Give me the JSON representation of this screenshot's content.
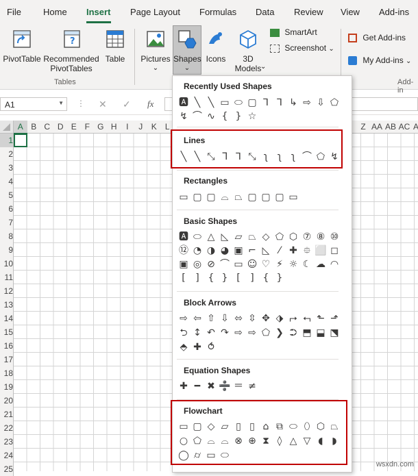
{
  "tabs": [
    "File",
    "Home",
    "Insert",
    "Page Layout",
    "Formulas",
    "Data",
    "Review",
    "View",
    "Add-ins"
  ],
  "active_tab": "Insert",
  "ribbon": {
    "pivottable": "PivotTable",
    "recommended_line1": "Recommended",
    "recommended_line2": "PivotTables",
    "table": "Table",
    "tables_group": "Tables",
    "pictures": "Pictures",
    "shapes": "Shapes",
    "icons": "Icons",
    "models_line1": "3D",
    "models_line2": "Models",
    "smartart": "SmartArt",
    "screenshot": "Screenshot",
    "get_addins": "Get Add-ins",
    "my_addins": "My Add-ins",
    "addins_group": "Add-in",
    "chevron": "⌄"
  },
  "formula_bar": {
    "name_box": "A1",
    "fx": "fx",
    "cancel": "✕",
    "enter": "✓"
  },
  "columns_left": [
    "A",
    "B",
    "C",
    "D",
    "E",
    "F",
    "G",
    "H",
    "I",
    "J",
    "K",
    "L"
  ],
  "columns_right": [
    "Z",
    "AA",
    "AB",
    "AC",
    "A"
  ],
  "rows": [
    "1",
    "2",
    "3",
    "4",
    "5",
    "6",
    "7",
    "8",
    "9",
    "10",
    "11",
    "12",
    "13",
    "14",
    "15",
    "16",
    "17",
    "18",
    "19",
    "20",
    "21",
    "22",
    "23",
    "24",
    "25"
  ],
  "dropdown": {
    "recent": {
      "title": "Recently Used Shapes",
      "row1": [
        "🅰",
        "╲",
        "╲",
        "▭",
        "⬭",
        "▢",
        "⅂",
        "⅂",
        "↳",
        "⇨",
        "⇩",
        "⬠"
      ],
      "row2": [
        "↯",
        "⌒",
        "∿",
        "{",
        "}",
        "☆"
      ]
    },
    "lines": {
      "title": "Lines",
      "row1": [
        "╲",
        "╲",
        "⤡",
        "ᒣ",
        "⅂",
        "⤡",
        "ʅ",
        "ʅ",
        "ʅ",
        "⌒",
        "⬠",
        "↯"
      ]
    },
    "rectangles": {
      "title": "Rectangles",
      "row1": [
        "▭",
        "▢",
        "▢",
        "⌓",
        "⏢",
        "▢",
        "▢",
        "▢",
        "▭"
      ]
    },
    "basic": {
      "title": "Basic Shapes",
      "row1": [
        "🅰",
        "⬭",
        "△",
        "◺",
        "▱",
        "⏢",
        "◇",
        "⬠",
        "⬡",
        "⑦",
        "⑧",
        "⑩"
      ],
      "row2": [
        "⑫",
        "◔",
        "◑",
        "◕",
        "▣",
        "⌐",
        "◺",
        "⁄",
        "✚",
        "⯐",
        "⬜",
        "◻"
      ],
      "row3": [
        "▣",
        "◎",
        "⊘",
        "⌒",
        "▭",
        "☺",
        "♡",
        "⚡",
        "☼",
        "☾",
        "☁",
        "◠"
      ],
      "row4": [
        "[",
        "]",
        "{",
        "}",
        "[",
        "]",
        "{",
        "}"
      ]
    },
    "arrows": {
      "title": "Block Arrows",
      "row1": [
        "⇨",
        "⇦",
        "⇧",
        "⇩",
        "⬄",
        "⇳",
        "✥",
        "⬗",
        "⮣",
        "⮢",
        "⬑",
        "⬏"
      ],
      "row2": [
        "⮌",
        "↕",
        "↶",
        "↷",
        "⇨",
        "⇨",
        "⬠",
        "❯",
        "⮊",
        "⬒",
        "⬓",
        "⬔"
      ],
      "row3": [
        "⬘",
        "✚",
        "⥀"
      ]
    },
    "equation": {
      "title": "Equation Shapes",
      "row1": [
        "✚",
        "━",
        "✖",
        "➗",
        "＝",
        "≠"
      ]
    },
    "flowchart": {
      "title": "Flowchart",
      "row1": [
        "▭",
        "▢",
        "◇",
        "▱",
        "▯",
        "▯",
        "⌂",
        "⧉",
        "⬭",
        "⬯",
        "⬡",
        "⏢"
      ],
      "row2": [
        "○",
        "⬠",
        "⌓",
        "⌓",
        "⊗",
        "⊕",
        "⧗",
        "◊",
        "△",
        "▽",
        "◖",
        "◗"
      ],
      "row3": [
        "◯",
        "⌭",
        "▭",
        "⬭"
      ]
    }
  },
  "watermark": "wsxdn.com",
  "colors": {
    "accent": "#1e7145",
    "highlight": "#c00000"
  }
}
